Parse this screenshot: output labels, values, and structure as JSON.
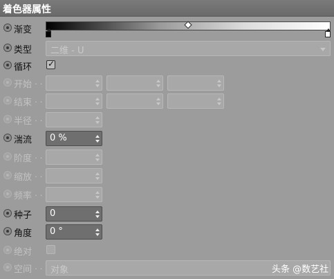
{
  "header": {
    "title": "着色器属性"
  },
  "rows": {
    "gradient": {
      "label": "渐变"
    },
    "type": {
      "label": "类型",
      "value": "二维 - U"
    },
    "cycle": {
      "label": "循环",
      "checked": true
    },
    "start": {
      "label": "开始"
    },
    "end": {
      "label": "结束"
    },
    "radius": {
      "label": "半径"
    },
    "turbulence": {
      "label": "湍流",
      "value": "0 %"
    },
    "octaves": {
      "label": "阶度"
    },
    "scale": {
      "label": "缩放"
    },
    "frequency": {
      "label": "频率"
    },
    "seed": {
      "label": "种子",
      "value": "0"
    },
    "angle": {
      "label": "角度",
      "value": "0 °"
    },
    "absolute": {
      "label": "绝对",
      "checked": false
    },
    "space": {
      "label": "空间",
      "value": "对象"
    }
  },
  "dots": ". .",
  "watermark": "头条 @数艺社"
}
